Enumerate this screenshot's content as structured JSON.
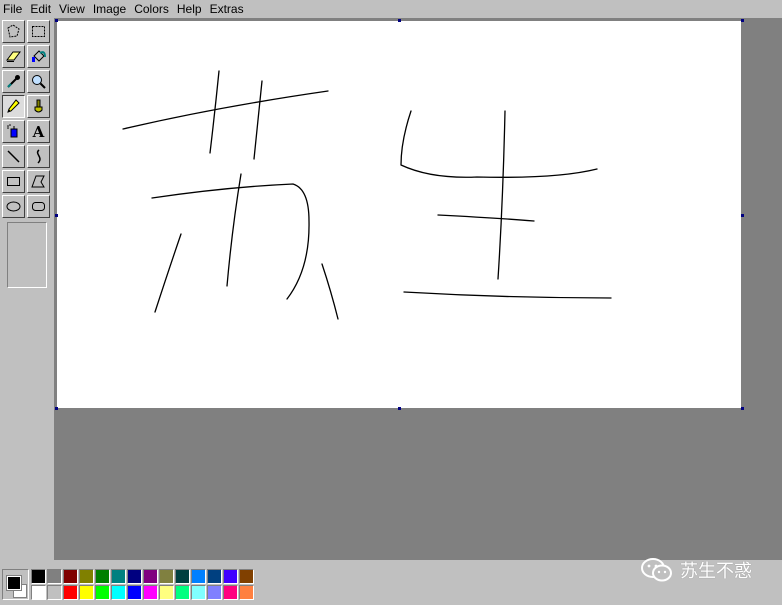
{
  "menu": [
    {
      "id": "file",
      "label": "File"
    },
    {
      "id": "edit",
      "label": "Edit"
    },
    {
      "id": "view",
      "label": "View"
    },
    {
      "id": "image",
      "label": "Image"
    },
    {
      "id": "colors",
      "label": "Colors"
    },
    {
      "id": "help",
      "label": "Help"
    },
    {
      "id": "extras",
      "label": "Extras"
    }
  ],
  "tools": [
    {
      "id": "free-select",
      "icon": "free-form-select-icon"
    },
    {
      "id": "select",
      "icon": "rect-select-icon"
    },
    {
      "id": "eraser",
      "icon": "eraser-icon"
    },
    {
      "id": "fill",
      "icon": "fill-bucket-icon"
    },
    {
      "id": "picker",
      "icon": "color-picker-icon"
    },
    {
      "id": "magnifier",
      "icon": "magnifier-icon"
    },
    {
      "id": "pencil",
      "icon": "pencil-icon",
      "active": true
    },
    {
      "id": "brush",
      "icon": "brush-icon"
    },
    {
      "id": "airbrush",
      "icon": "airbrush-icon"
    },
    {
      "id": "text",
      "icon": "text-icon",
      "glyph": "A"
    },
    {
      "id": "line",
      "icon": "line-icon"
    },
    {
      "id": "curve",
      "icon": "curve-icon"
    },
    {
      "id": "rectangle",
      "icon": "rectangle-icon"
    },
    {
      "id": "polygon",
      "icon": "polygon-icon"
    },
    {
      "id": "ellipse",
      "icon": "ellipse-icon"
    },
    {
      "id": "rounded-rect",
      "icon": "rounded-rectangle-icon"
    }
  ],
  "palette": {
    "foreground": "#000000",
    "background": "#ffffff",
    "colors_top": [
      "#000000",
      "#808080",
      "#800000",
      "#808000",
      "#008000",
      "#008080",
      "#000080",
      "#800080",
      "#808040",
      "#004040",
      "#0080ff",
      "#004080",
      "#4000ff",
      "#804000"
    ],
    "colors_bottom": [
      "#ffffff",
      "#c0c0c0",
      "#ff0000",
      "#ffff00",
      "#00ff00",
      "#00ffff",
      "#0000ff",
      "#ff00ff",
      "#ffff80",
      "#00ff80",
      "#80ffff",
      "#8080ff",
      "#ff0080",
      "#ff8040"
    ]
  },
  "watermark": {
    "text": "苏生不惑",
    "icon": "wechat-icon"
  }
}
